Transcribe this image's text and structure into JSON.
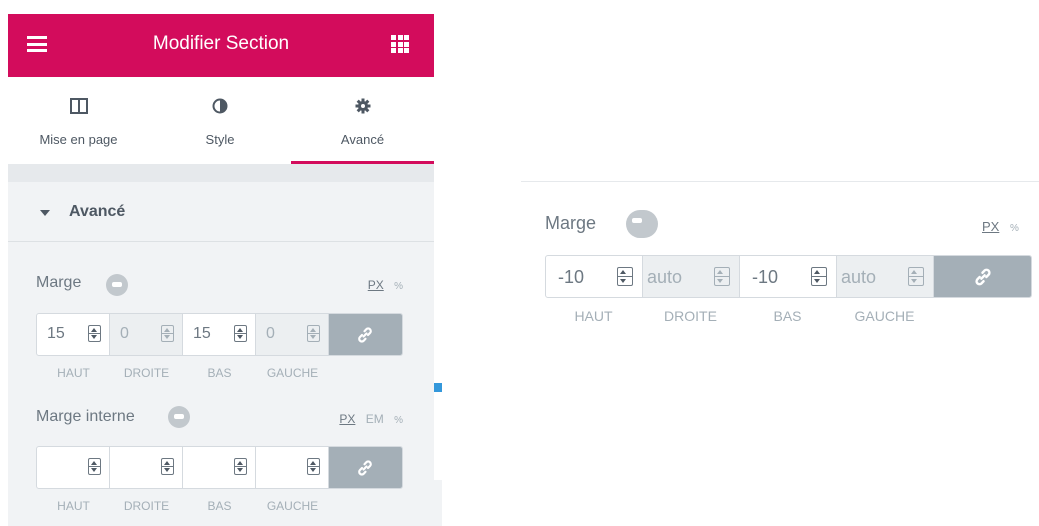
{
  "header": {
    "title": "Modifier Section"
  },
  "tabs": [
    {
      "label": "Mise en page",
      "icon": "columns-icon"
    },
    {
      "label": "Style",
      "icon": "half-circle-icon"
    },
    {
      "label": "Avancé",
      "icon": "gear-icon",
      "active": true
    }
  ],
  "section": {
    "title": "Avancé"
  },
  "margin": {
    "label": "Marge",
    "units": [
      "PX",
      "%"
    ],
    "active_unit": "PX",
    "values": [
      "15",
      "0",
      "15",
      "0"
    ],
    "sides": [
      "HAUT",
      "DROITE",
      "BAS",
      "GAUCHE"
    ]
  },
  "padding": {
    "label": "Marge interne",
    "units": [
      "PX",
      "EM",
      "%"
    ],
    "active_unit": "PX",
    "values": [
      "",
      "",
      "",
      ""
    ],
    "sides": [
      "HAUT",
      "DROITE",
      "BAS",
      "GAUCHE"
    ]
  },
  "zoom_margin": {
    "label": "Marge",
    "units": [
      "PX",
      "%"
    ],
    "active_unit": "PX",
    "values": [
      "-10",
      "auto",
      "-10",
      "auto"
    ],
    "disabled": [
      false,
      true,
      false,
      true
    ],
    "sides": [
      "HAUT",
      "DROITE",
      "BAS",
      "GAUCHE"
    ]
  },
  "colors": {
    "accent": "#d30c5c",
    "link_button": "#a4afb7",
    "text": "#6d7882"
  }
}
